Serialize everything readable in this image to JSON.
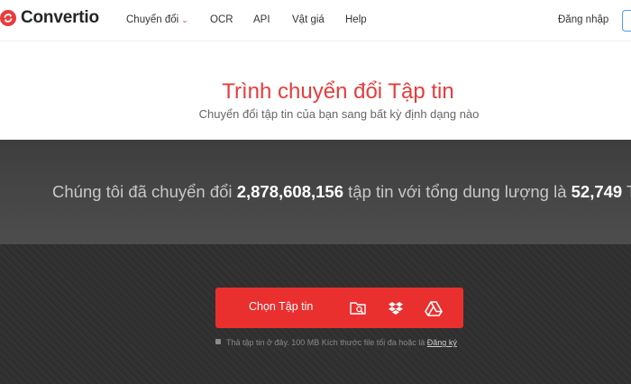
{
  "header": {
    "logo_text": "Convertio",
    "nav": [
      {
        "label": "Chuyển đổi",
        "has_dropdown": true
      },
      {
        "label": "OCR"
      },
      {
        "label": "API"
      },
      {
        "label": "Vật giá"
      },
      {
        "label": "Help"
      }
    ],
    "login_label": "Đăng nhập"
  },
  "hero": {
    "title": "Trình chuyển đổi Tập tin",
    "subtitle": "Chuyển đổi tập tin của bạn sang bất kỳ định dạng nào"
  },
  "stats": {
    "prefix": "Chúng tôi đã chuyển đổi",
    "file_count": "2,878,608,156",
    "middle": "tập tin với tổng dung lượng là",
    "total_size": "52,749",
    "unit": "TB"
  },
  "upload": {
    "button_label": "Chọn Tập tin",
    "sources": [
      "folder-search-icon",
      "dropbox-icon",
      "google-drive-icon"
    ],
    "hint_text": "Thả tập tin ở đây. 100 MB Kích thước file tối đa hoặc là",
    "hint_link": "Đăng ký"
  },
  "colors": {
    "accent": "#e9302f",
    "stats_bg": "#454545",
    "upload_bg": "#2f2f2f"
  }
}
